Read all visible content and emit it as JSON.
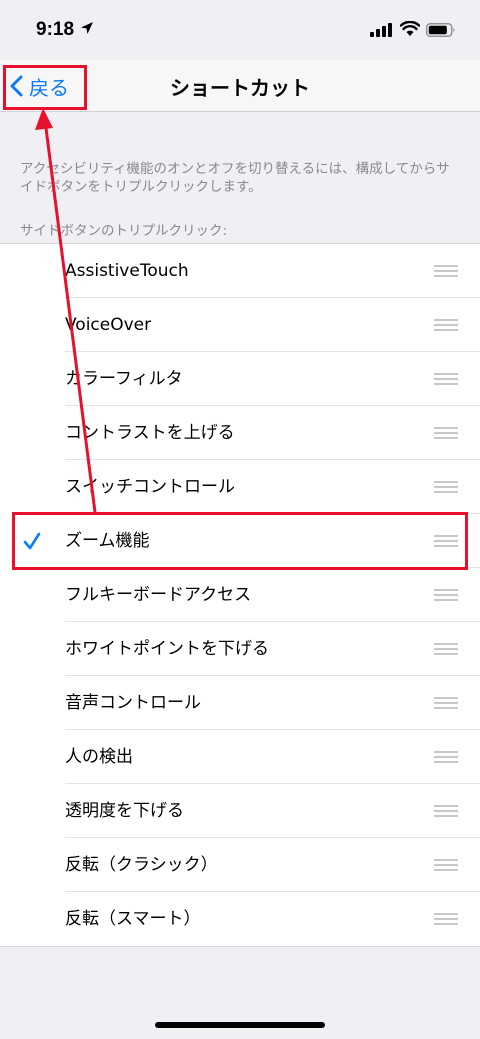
{
  "status_bar": {
    "time": "9:18"
  },
  "nav": {
    "back_label": "戻る",
    "title": "ショートカット"
  },
  "description": "アクセシビリティ機能のオンとオフを切り替えるには、構成してからサイドボタンをトリプルクリックします。",
  "section_header": "サイドボタンのトリプルクリック:",
  "items": [
    {
      "label": "AssistiveTouch",
      "checked": false
    },
    {
      "label": "VoiceOver",
      "checked": false
    },
    {
      "label": "カラーフィルタ",
      "checked": false
    },
    {
      "label": "コントラストを上げる",
      "checked": false
    },
    {
      "label": "スイッチコントロール",
      "checked": false
    },
    {
      "label": "ズーム機能",
      "checked": true
    },
    {
      "label": "フルキーボードアクセス",
      "checked": false
    },
    {
      "label": "ホワイトポイントを下げる",
      "checked": false
    },
    {
      "label": "音声コントロール",
      "checked": false
    },
    {
      "label": "人の検出",
      "checked": false
    },
    {
      "label": "透明度を下げる",
      "checked": false
    },
    {
      "label": "反転（クラシック）",
      "checked": false
    },
    {
      "label": "反転（スマート）",
      "checked": false
    }
  ],
  "colors": {
    "accent": "#0a7aff",
    "annotation": "#e8112d"
  }
}
